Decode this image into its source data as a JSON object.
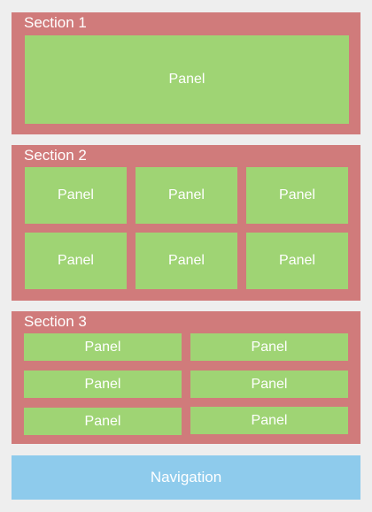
{
  "colors": {
    "background": "#eeeeee",
    "section": "#d07b7b",
    "panel": "#9fd474",
    "navigation": "#8ecbec",
    "text": "#ffffff"
  },
  "sections": [
    {
      "title": "Section 1",
      "panels": [
        "Panel"
      ]
    },
    {
      "title": "Section 2",
      "panels": [
        "Panel",
        "Panel",
        "Panel",
        "Panel",
        "Panel",
        "Panel"
      ]
    },
    {
      "title": "Section 3",
      "panels": [
        "Panel",
        "Panel",
        "Panel",
        "Panel",
        "Panel",
        "Panel"
      ]
    }
  ],
  "navigation": {
    "label": "Navigation"
  }
}
